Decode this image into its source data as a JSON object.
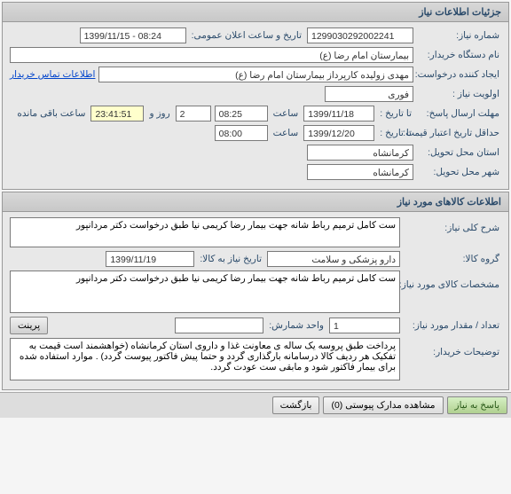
{
  "panel1": {
    "title": "جزئیات اطلاعات نیاز",
    "labels": {
      "need_no": "شماره نیاز:",
      "announce": "تاریخ و ساعت اعلان عمومی:",
      "buyer_name": "نام دستگاه خریدار:",
      "requester": "ایجاد کننده درخواست:",
      "priority": "اولویت نیاز :",
      "deadline": "مهلت ارسال پاسخ:",
      "to_date": "تا تاریخ :",
      "hour": "ساعت",
      "days": "روز و",
      "remaining": "ساعت باقی مانده",
      "min_validity": "حداقل تاریخ اعتبار قیمت:",
      "province": "استان محل تحویل:",
      "city": "شهر محل تحویل:",
      "contact_link": "اطلاعات تماس خریدار"
    },
    "values": {
      "need_no": "1299030292002241",
      "announce": "1399/11/15 - 08:24",
      "buyer_name": "بیمارستان امام رضا (ع)",
      "requester": "مهدی زولیده کارپرداز بیمارستان امام رضا (ع)",
      "priority": "فوری",
      "deadline_date": "1399/11/18",
      "deadline_time": "08:25",
      "days": "2",
      "countdown": "23:41:51",
      "min_validity_date": "1399/12/20",
      "min_validity_time": "08:00",
      "province": "کرمانشاه",
      "city": "کرمانشاه"
    }
  },
  "panel2": {
    "title": "اطلاعات کالاهای مورد نیاز",
    "labels": {
      "general_desc": "شرح کلی نیاز:",
      "group": "گروه کالا:",
      "date_to": "تاریخ نیاز به کالا:",
      "specs": "مشخصات کالای مورد نیاز:",
      "qty": "تعداد / مقدار مورد نیاز:",
      "unit": "واحد شمارش:",
      "buyer_notes": "توضیحات خریدار:",
      "print": "پرینت"
    },
    "values": {
      "general_desc": "ست کامل ترمیم رباط شانه جهت بیمار رضا کریمی نیا طبق درخواست دکتر مردانپور",
      "group": "دارو پزشکی و سلامت",
      "date_to": "1399/11/19",
      "specs": "ست کامل ترمیم رباط شانه جهت بیمار رضا کریمی نیا طبق درخواست دکتر مردانپور",
      "qty": "1",
      "unit": "",
      "buyer_notes": "پرداخت طبق پروسه یک ساله ی معاونت غذا و داروی استان کرمانشاه (خواهشمند است قیمت به تفکیک هر ردیف کالا درسامانه بارگذاری گردد و حتما پیش فاکتور پیوست گردد) . موارد استفاده شده برای بیمار فاکتور شود و مابقی ست عودت گردد."
    }
  },
  "buttons": {
    "reply": "پاسخ به نیاز",
    "attachments": "مشاهده مدارک پیوستی (0)",
    "back": "بازگشت"
  }
}
